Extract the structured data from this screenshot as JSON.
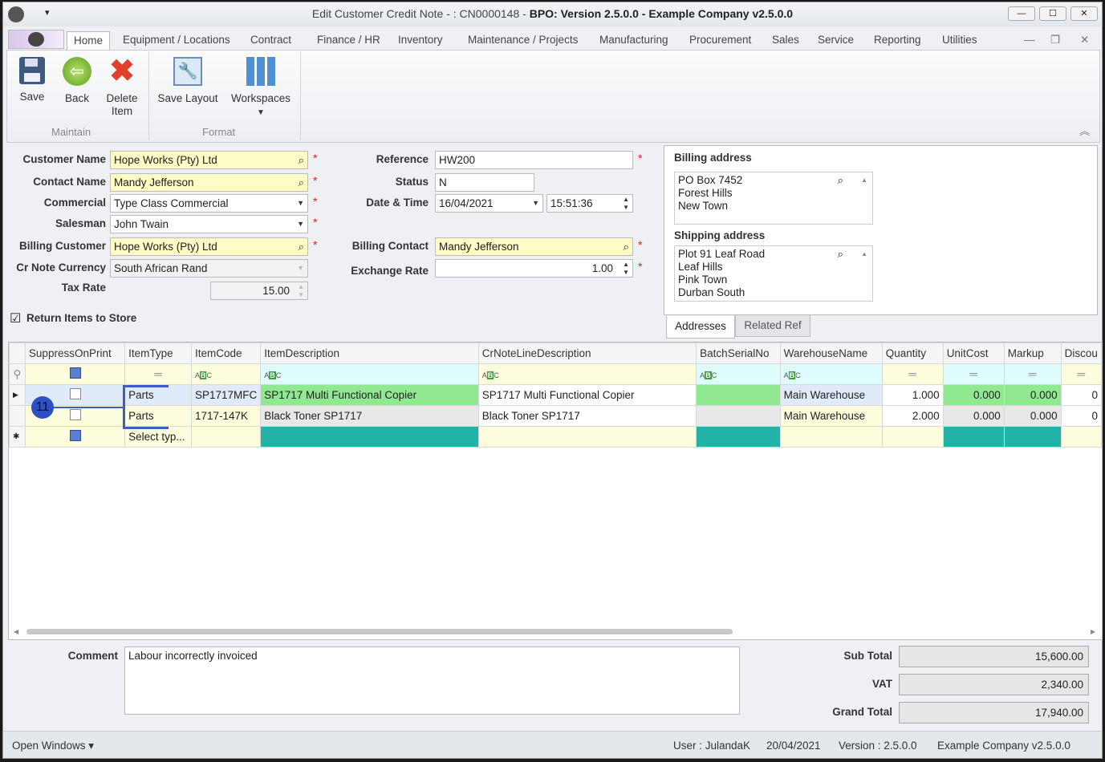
{
  "window": {
    "title_prefix": "Edit Customer Credit Note - : CN0000148 - ",
    "title_bold": "BPO: Version 2.5.0.0 - Example Company v2.5.0.0",
    "minimize": "—",
    "maximize": "☐",
    "close": "✕"
  },
  "tabs": [
    "Home",
    "Equipment / Locations",
    "Contract",
    "Finance / HR",
    "Inventory",
    "Maintenance / Projects",
    "Manufacturing",
    "Procurement",
    "Sales",
    "Service",
    "Reporting",
    "Utilities"
  ],
  "ribbon": {
    "save": "Save",
    "back": "Back",
    "delete1": "Delete",
    "delete2": "Item",
    "save_layout": "Save Layout",
    "workspaces": "Workspaces",
    "group_maintain": "Maintain",
    "group_format": "Format"
  },
  "form": {
    "customer_name_label": "Customer Name",
    "customer_name": "Hope Works (Pty) Ltd",
    "contact_name_label": "Contact Name",
    "contact_name": "Mandy Jefferson",
    "commercial_label": "Commercial",
    "commercial": "Type Class Commercial",
    "salesman_label": "Salesman",
    "salesman": "John Twain",
    "billing_customer_label": "Billing Customer",
    "billing_customer": "Hope Works (Pty) Ltd",
    "currency_label": "Cr Note Currency",
    "currency": "South African Rand",
    "tax_rate_label": "Tax Rate",
    "tax_rate": "15.00",
    "reference_label": "Reference",
    "reference": "HW200",
    "status_label": "Status",
    "status": "N",
    "datetime_label": "Date & Time",
    "date": "16/04/2021",
    "time": "15:51:36",
    "billing_contact_label": "Billing Contact",
    "billing_contact": "Mandy Jefferson",
    "exchange_rate_label": "Exchange Rate",
    "exchange_rate": "1.00",
    "return_items_label": "Return Items to Store",
    "return_items_checked": true
  },
  "addresses": {
    "billing_title": "Billing address",
    "billing": [
      "PO Box 7452",
      "Forest Hills",
      "New Town"
    ],
    "shipping_title": "Shipping address",
    "shipping": [
      "Plot 91 Leaf Road",
      "Leaf Hills",
      "Pink Town",
      "Durban South"
    ],
    "tab_addresses": "Addresses",
    "tab_related": "Related Ref"
  },
  "grid": {
    "columns": [
      "SuppressOnPrint",
      "ItemType",
      "ItemCode",
      "ItemDescription",
      "CrNoteLineDescription",
      "BatchSerialNo",
      "WarehouseName",
      "Quantity",
      "UnitCost",
      "Markup",
      "Discou"
    ],
    "rows": [
      {
        "type": "Parts",
        "code": "SP1717MFC",
        "desc": "SP1717 Multi Functional Copier",
        "line_desc": "SP1717 Multi Functional Copier",
        "batch": "",
        "warehouse": "Main Warehouse",
        "qty": "1.000",
        "unit_cost": "0.000",
        "markup": "0.000",
        "discount": "0"
      },
      {
        "type": "Parts",
        "code": "1717-147K",
        "desc": "Black Toner SP1717",
        "line_desc": "Black Toner SP1717",
        "batch": "",
        "warehouse": "Main Warehouse",
        "qty": "2.000",
        "unit_cost": "0.000",
        "markup": "0.000",
        "discount": "0"
      }
    ],
    "new_row_type": "Select typ...",
    "callout": "11"
  },
  "footer": {
    "comment_label": "Comment",
    "comment": "Labour incorrectly invoiced",
    "subtotal_label": "Sub Total",
    "subtotal": "15,600.00",
    "vat_label": "VAT",
    "vat": "2,340.00",
    "grand_total_label": "Grand Total",
    "grand_total": "17,940.00"
  },
  "status": {
    "open_windows": "Open Windows ▾",
    "user": "User : JulandaK",
    "date": "20/04/2021",
    "version": "Version : 2.5.0.0",
    "company": "Example Company v2.5.0.0"
  }
}
